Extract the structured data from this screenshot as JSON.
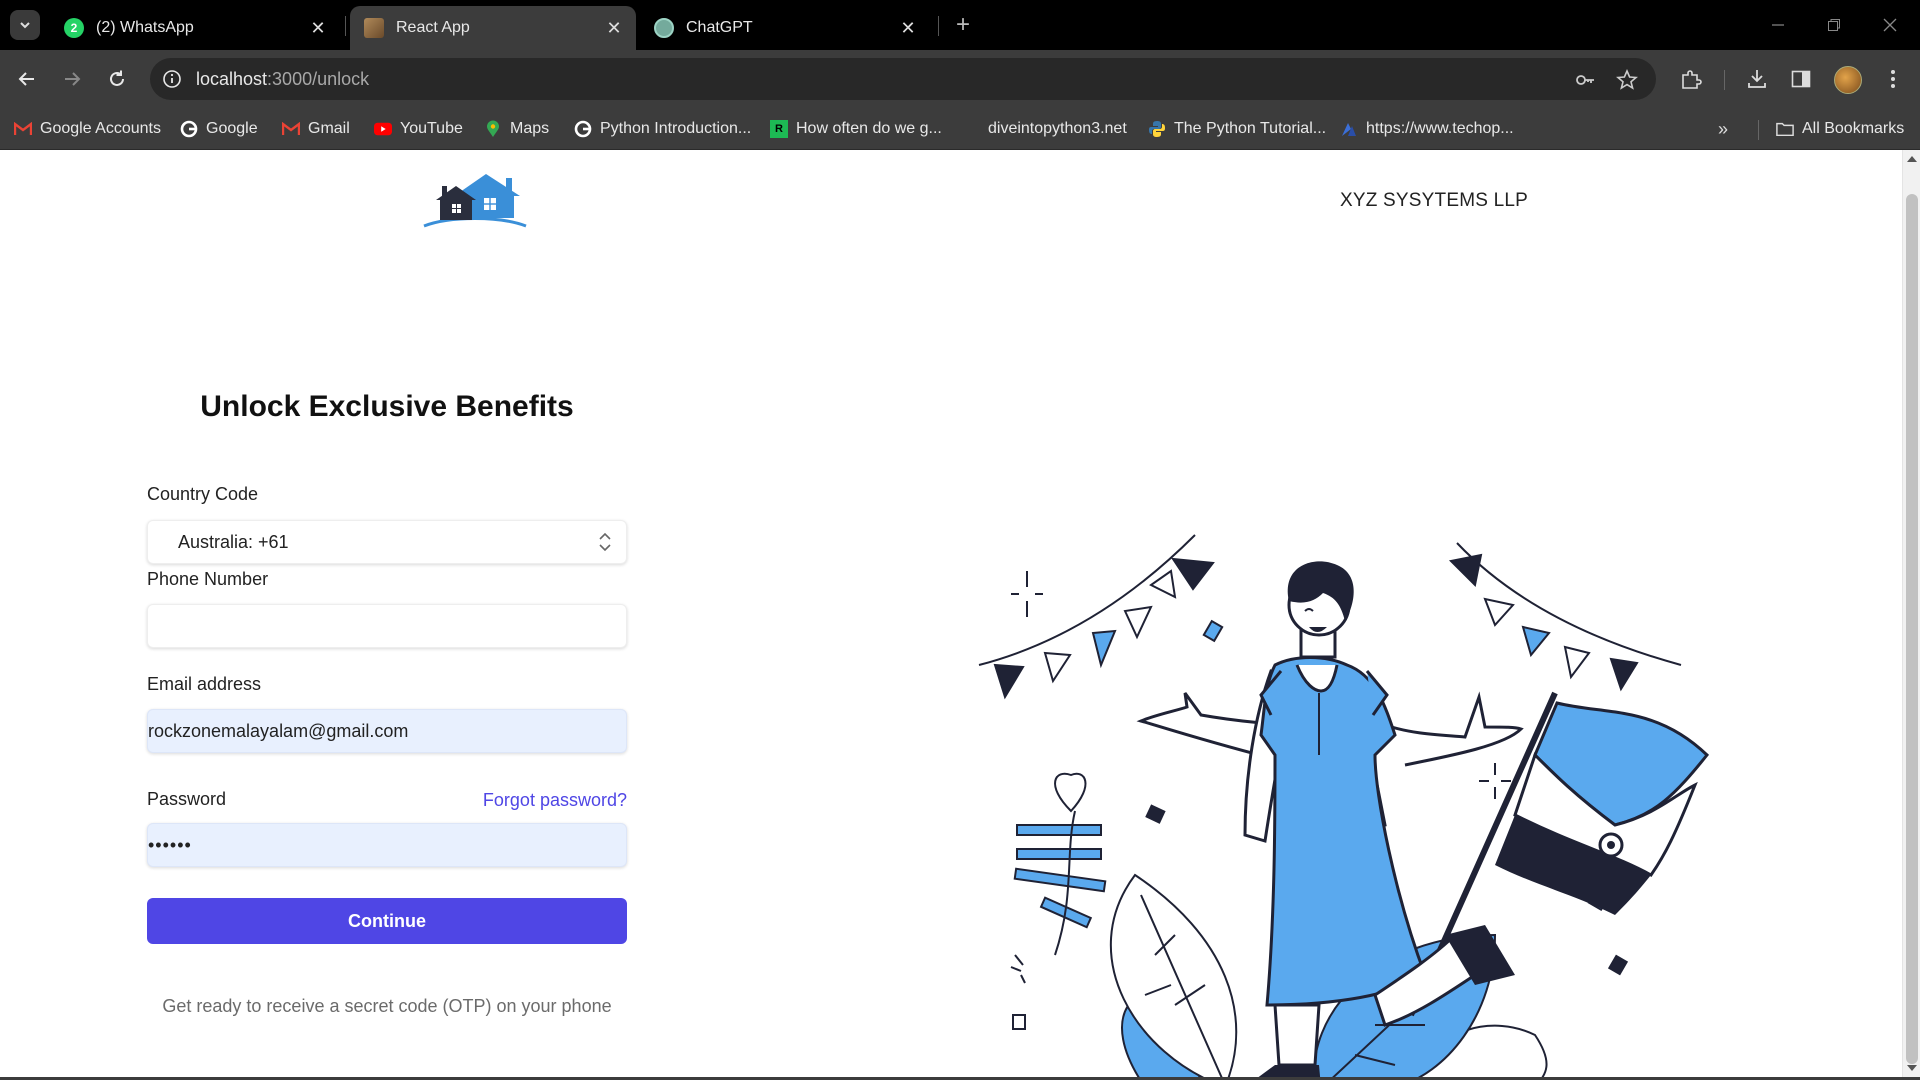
{
  "browser": {
    "tabs": [
      {
        "title": "(2) WhatsApp",
        "icon": "whatsapp-icon",
        "active": false
      },
      {
        "title": "React App",
        "icon": "react-app-icon",
        "active": true
      },
      {
        "title": "ChatGPT",
        "icon": "chatgpt-icon",
        "active": false
      }
    ],
    "url_host": "localhost",
    "url_path": ":3000/unlock",
    "bookmarks": [
      {
        "label": "Google Accounts",
        "icon": "gmail-icon"
      },
      {
        "label": "Google",
        "icon": "google-icon"
      },
      {
        "label": "Gmail",
        "icon": "gmail-icon"
      },
      {
        "label": "YouTube",
        "icon": "youtube-icon"
      },
      {
        "label": "Maps",
        "icon": "maps-icon"
      },
      {
        "label": "Python Introduction...",
        "icon": "google-icon"
      },
      {
        "label": "How often do we g...",
        "icon": "rk-icon"
      },
      {
        "label": "diveintopython3.net",
        "icon": "none"
      },
      {
        "label": "The Python Tutorial...",
        "icon": "python-icon"
      },
      {
        "label": "https://www.techop...",
        "icon": "techop-icon"
      }
    ],
    "all_bookmarks": "All Bookmarks"
  },
  "header": {
    "company": "XYZ SYSYTEMS LLP"
  },
  "form": {
    "title": "Unlock Exclusive Benefits",
    "country_label": "Country Code",
    "country_value": "Australia: +61",
    "phone_label": "Phone Number",
    "phone_value": "",
    "email_label": "Email address",
    "email_value": "rockzonemalayalam@gmail.com",
    "password_label": "Password",
    "forgot_label": "Forgot password?",
    "password_value": "••••••",
    "continue_label": "Continue",
    "hint": "Get ready to receive a secret code (OTP) on your phone"
  },
  "colors": {
    "accent": "#4f46e5",
    "illustration_blue": "#5aa9ee",
    "illustration_dark": "#1f2235"
  }
}
